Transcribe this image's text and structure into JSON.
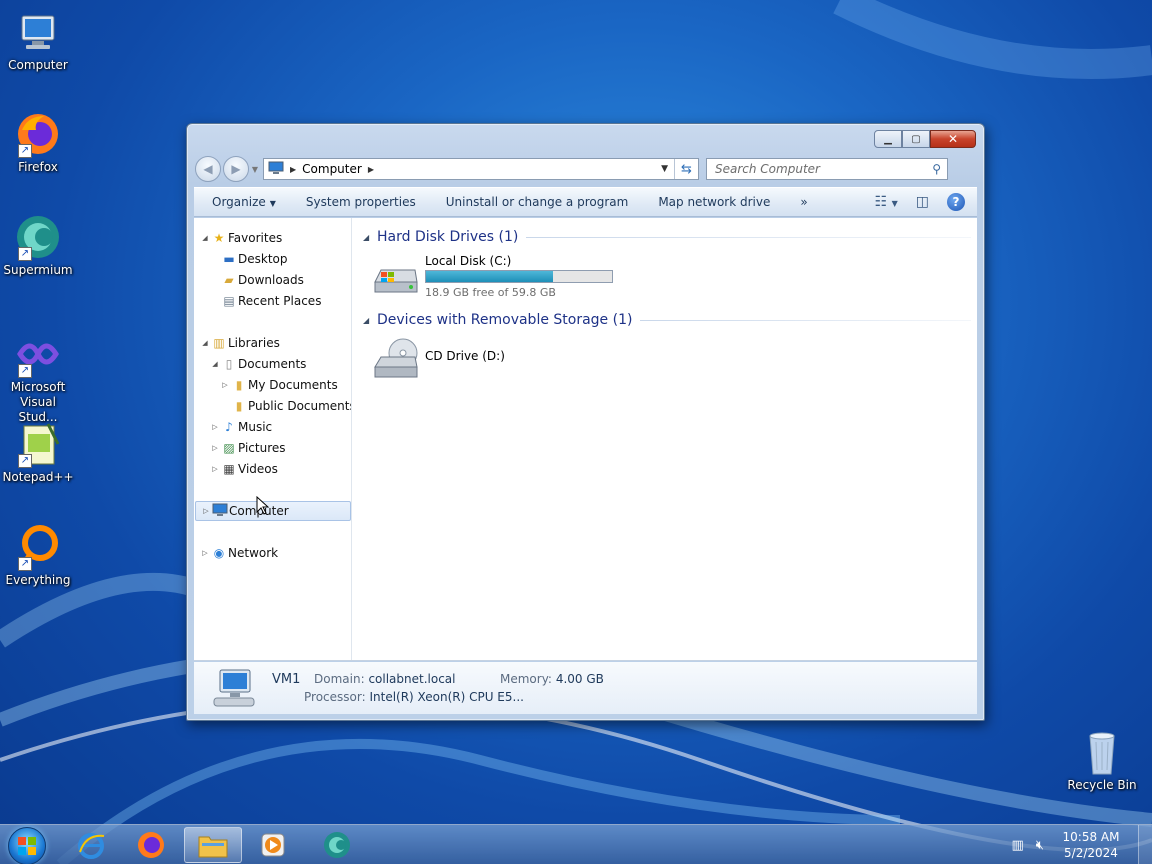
{
  "desktop": {
    "icons": [
      {
        "label": "Computer",
        "icon": "computer-icon"
      },
      {
        "label": "Firefox",
        "icon": "firefox-icon"
      },
      {
        "label": "Supermium",
        "icon": "supermium-icon"
      },
      {
        "label": "Microsoft Visual Stud...",
        "icon": "visual-studio-icon"
      },
      {
        "label": "Notepad++",
        "icon": "notepadpp-icon"
      },
      {
        "label": "Everything",
        "icon": "everything-icon"
      },
      {
        "label": "Recycle Bin",
        "icon": "recycle-bin-icon"
      }
    ]
  },
  "window": {
    "address": {
      "crumb": "Computer"
    },
    "search": {
      "placeholder": "Search Computer"
    },
    "commands": {
      "organize": "Organize",
      "system_properties": "System properties",
      "uninstall": "Uninstall or change a program",
      "map_drive": "Map network drive",
      "more": "»"
    },
    "nav": {
      "favorites": "Favorites",
      "desktop": "Desktop",
      "downloads": "Downloads",
      "recent_places": "Recent Places",
      "libraries": "Libraries",
      "documents": "Documents",
      "my_documents": "My Documents",
      "public_documents": "Public Documents",
      "music": "Music",
      "pictures": "Pictures",
      "videos": "Videos",
      "computer": "Computer",
      "network": "Network"
    },
    "groups": {
      "hdd_header": "Hard Disk Drives (1)",
      "removable_header": "Devices with Removable Storage (1)"
    },
    "drives": {
      "c_name": "Local Disk (C:)",
      "c_free": "18.9 GB free of 59.8 GB",
      "c_used_fraction": 0.684,
      "d_name": "CD Drive (D:)"
    },
    "details": {
      "name": "VM1",
      "domain_label": "Domain:",
      "domain_value": "collabnet.local",
      "memory_label": "Memory:",
      "memory_value": "4.00 GB",
      "processor_label": "Processor:",
      "processor_value": "Intel(R) Xeon(R) CPU E5..."
    }
  },
  "taskbar": {
    "clock_time": "10:58 AM",
    "clock_date": "5/2/2024"
  },
  "colors": {
    "accent": "#1e3287",
    "bar_fill": "#26a0da"
  }
}
